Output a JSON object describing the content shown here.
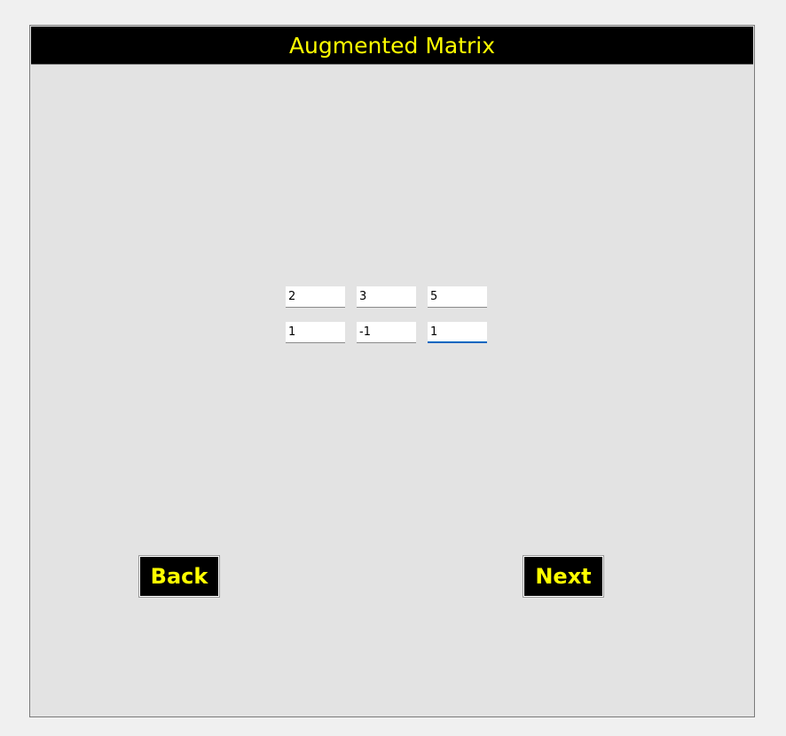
{
  "window": {
    "title": "Augmented Matrix"
  },
  "matrix": {
    "rows": [
      [
        "2",
        "3",
        "5"
      ],
      [
        "1",
        "-1",
        "1"
      ]
    ],
    "focused_cell": "row 2, column 3"
  },
  "buttons": {
    "back_label": "Back",
    "next_label": "Next"
  },
  "colors": {
    "title_bg": "#000000",
    "title_fg": "#ffff00",
    "button_bg": "#000000",
    "button_fg": "#ffff00",
    "panel_bg": "#e3e3e3",
    "focus_accent": "#0067c0"
  }
}
